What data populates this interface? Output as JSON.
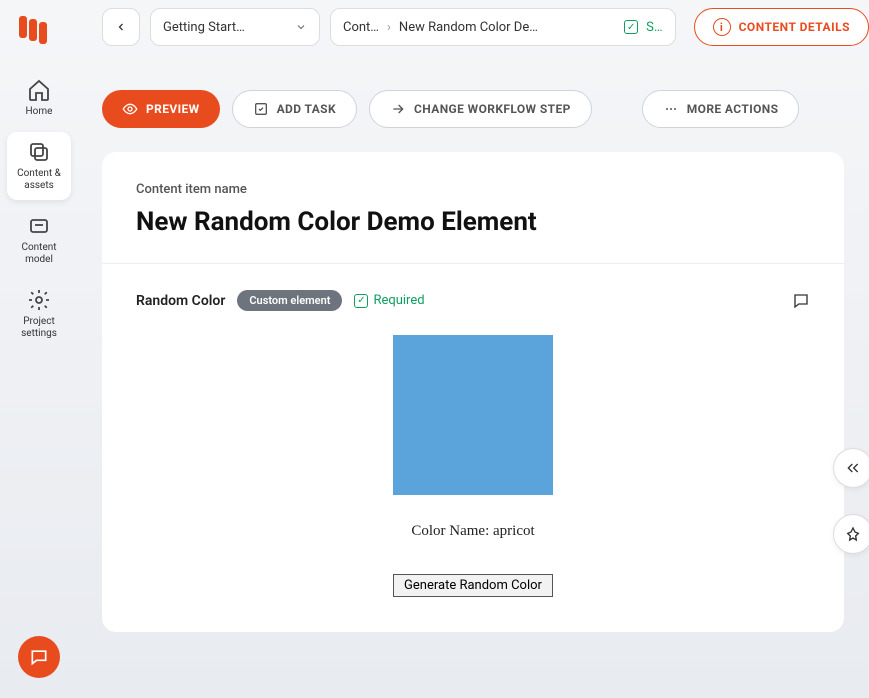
{
  "sidebar": {
    "items": [
      {
        "label": "Home"
      },
      {
        "label": "Content & assets"
      },
      {
        "label": "Content model"
      },
      {
        "label": "Project settings"
      }
    ]
  },
  "breadcrumb": {
    "project": "Getting Start…",
    "parent": "Cont…",
    "current": "New Random Color De…",
    "status": "S…"
  },
  "header": {
    "details_button": "CONTENT DETAILS"
  },
  "actions": {
    "preview": "PREVIEW",
    "add_task": "ADD TASK",
    "change_workflow": "CHANGE WORKFLOW STEP",
    "more": "MORE ACTIONS"
  },
  "content": {
    "name_label": "Content item name",
    "title": "New Random Color Demo Element",
    "element": {
      "name": "Random Color",
      "badge": "Custom element",
      "required_label": "Required",
      "color_hex": "#5ba3db",
      "color_name_prefix": "Color Name: ",
      "color_name": "apricot",
      "generate_button": "Generate Random Color"
    }
  }
}
